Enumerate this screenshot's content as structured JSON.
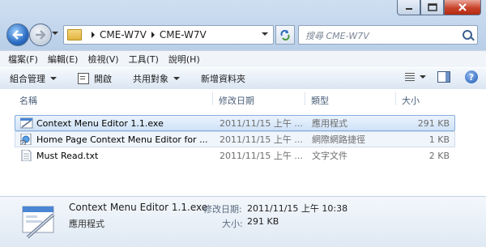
{
  "window": {
    "caption_buttons": [
      {
        "name": "minimize-button",
        "icon": "minimize-icon"
      },
      {
        "name": "maximize-button",
        "icon": "maximize-icon"
      },
      {
        "name": "close-button",
        "icon": "close-icon"
      }
    ]
  },
  "address": {
    "crumbs": [
      "CME-W7V",
      "CME-W7V"
    ],
    "search_placeholder": "搜尋 CME-W7V"
  },
  "menu": [
    "檔案(F)",
    "編輯(E)",
    "檢視(V)",
    "工具(T)",
    "說明(H)"
  ],
  "toolbar": {
    "organize": "組合管理",
    "open": "開啟",
    "share": "共用對象",
    "new_folder": "新增資料夾"
  },
  "columns": {
    "name": "名稱",
    "date": "修改日期",
    "type": "類型",
    "size": "大小"
  },
  "files": [
    {
      "name": "Context Menu Editor 1.1.exe",
      "date": "2011/11/15 上午 ...",
      "type": "應用程式",
      "size": "291 KB",
      "icon": "exe-icon",
      "state": "selected"
    },
    {
      "name": "Home Page Context Menu Editor for ...",
      "date": "2011/11/15 上午 ...",
      "type": "網際網路捷徑",
      "size": "1 KB",
      "icon": "url-shortcut-icon",
      "state": "hover"
    },
    {
      "name": "Must Read.txt",
      "date": "2011/11/15 上午 ...",
      "type": "文字文件",
      "size": "2 KB",
      "icon": "text-file-icon",
      "state": "normal"
    }
  ],
  "details": {
    "name": "Context Menu Editor 1.1.exe",
    "type": "應用程式",
    "date_label": "修改日期:",
    "date": "2011/11/15 上午 10:38",
    "size_label": "大小:",
    "size": "291 KB"
  },
  "colors": {
    "selection": "#cfe2f8",
    "selection_border": "#84acdd",
    "close_button": "#c8432b",
    "frame": "#b9cfe8"
  }
}
